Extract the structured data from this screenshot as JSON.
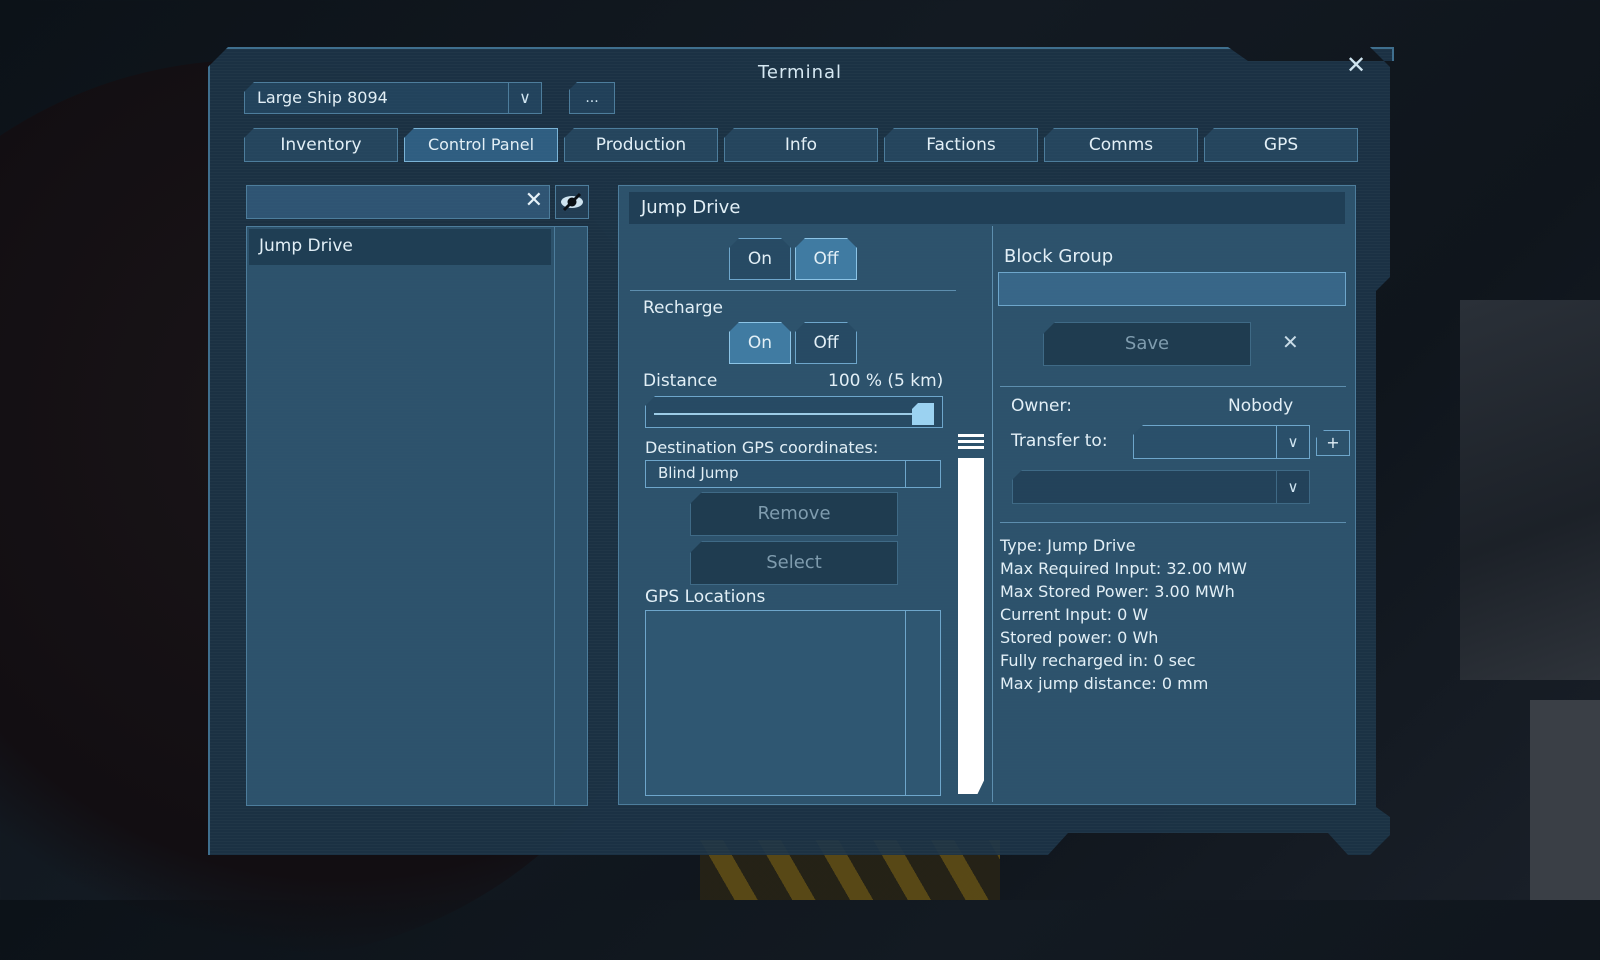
{
  "window": {
    "title": "Terminal",
    "close_icon": "close-icon"
  },
  "ship_selector": {
    "value": "Large Ship 8094",
    "more_label": "..."
  },
  "tabs": [
    {
      "label": "Inventory",
      "active": false
    },
    {
      "label": "Control Panel",
      "active": true
    },
    {
      "label": "Production",
      "active": false
    },
    {
      "label": "Info",
      "active": false
    },
    {
      "label": "Factions",
      "active": false
    },
    {
      "label": "Comms",
      "active": false
    },
    {
      "label": "GPS",
      "active": false
    }
  ],
  "block_search": {
    "value": "",
    "placeholder": ""
  },
  "block_list": {
    "items": [
      {
        "label": "Jump Drive",
        "selected": true
      }
    ]
  },
  "detail": {
    "title": "Jump Drive",
    "power": {
      "on_label": "On",
      "off_label": "Off",
      "state": "Off"
    },
    "recharge": {
      "label": "Recharge",
      "on_label": "On",
      "off_label": "Off",
      "state": "On"
    },
    "distance": {
      "label": "Distance",
      "value_text": "100 % (5 km)",
      "percent": 100
    },
    "destination": {
      "label": "Destination GPS coordinates:",
      "value": "Blind Jump"
    },
    "remove_label": "Remove",
    "select_label": "Select",
    "gps_locations_label": "GPS Locations",
    "gps_locations": []
  },
  "block_group": {
    "label": "Block Group",
    "value": "",
    "save_label": "Save"
  },
  "ownership": {
    "owner_label": "Owner:",
    "owner_value": "Nobody",
    "transfer_label": "Transfer to:",
    "transfer_value": "",
    "share_value": "",
    "add_label": "+"
  },
  "info_lines": [
    "Type: Jump Drive",
    "Max Required Input: 32.00 MW",
    "Max Stored Power: 3.00 MWh",
    "Current Input: 0 W",
    "Stored power: 0 Wh",
    "Fully recharged in: 0 sec",
    "Max jump distance: 0 mm"
  ]
}
